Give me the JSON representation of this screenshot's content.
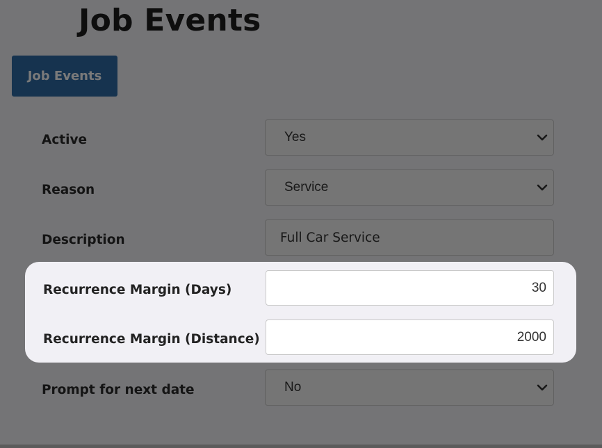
{
  "page": {
    "title": "Job Events"
  },
  "tab": {
    "label": "Job Events"
  },
  "form": {
    "active": {
      "label": "Active",
      "value": "Yes"
    },
    "reason": {
      "label": "Reason",
      "value": "Service"
    },
    "description": {
      "label": "Description",
      "value": "Full Car Service"
    },
    "recurrence_days": {
      "label": "Recurrence Margin (Days)",
      "value": "30"
    },
    "recurrence_distance": {
      "label": "Recurrence Margin (Distance)",
      "value": "2000"
    },
    "prompt_next_date": {
      "label": "Prompt for next date",
      "value": "No"
    }
  },
  "icons": {
    "dropdown": "chevron-down-icon"
  },
  "colors": {
    "accent": "#2f6ca5",
    "highlight_bg": "#f1f0f5"
  }
}
